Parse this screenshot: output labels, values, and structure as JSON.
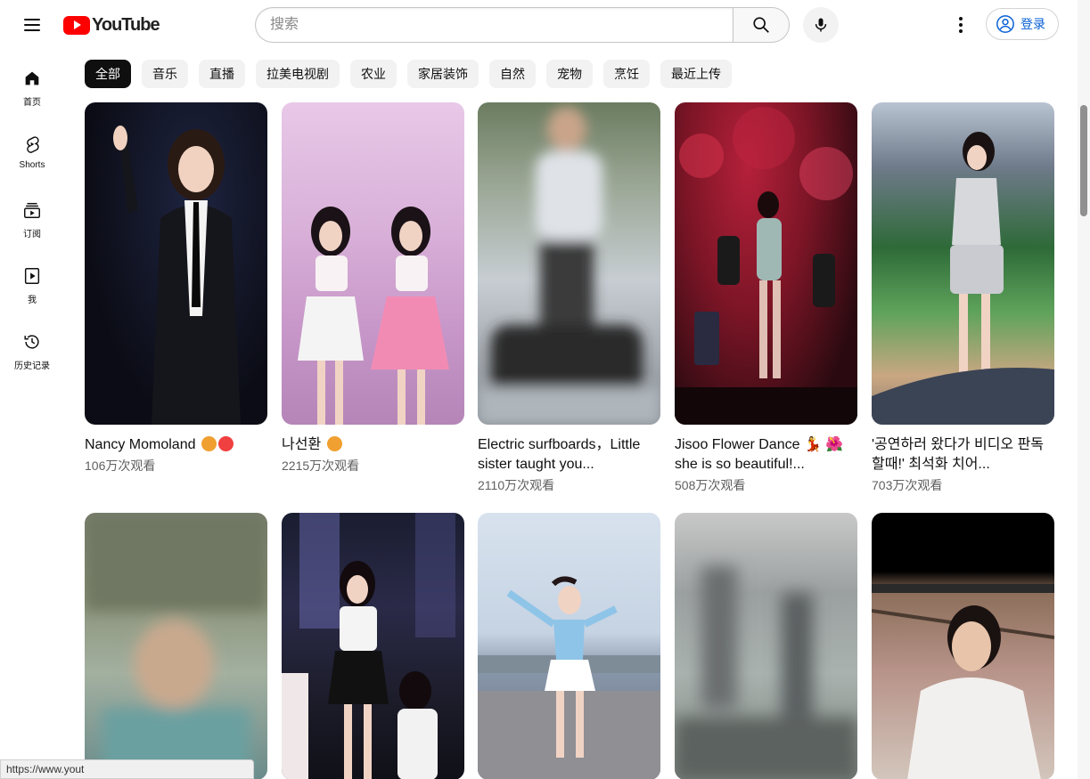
{
  "header": {
    "logo_text": "YouTube",
    "search_placeholder": "搜索",
    "signin_label": "登录"
  },
  "sidebar": {
    "items": [
      {
        "label": "首页",
        "icon": "home-icon"
      },
      {
        "label": "Shorts",
        "icon": "shorts-icon"
      },
      {
        "label": "订阅",
        "icon": "subscriptions-icon"
      },
      {
        "label": "我",
        "icon": "you-icon"
      },
      {
        "label": "历史记录",
        "icon": "history-icon"
      }
    ]
  },
  "chips": [
    "全部",
    "音乐",
    "直播",
    "拉美电视剧",
    "农业",
    "家居装饰",
    "自然",
    "宠物",
    "烹饪",
    "最近上传"
  ],
  "videos": [
    {
      "title": "Nancy Momoland",
      "emojis": [
        "#f0a030",
        "#f0a030"
      ],
      "views": "106万次观看"
    },
    {
      "title": "나선환",
      "emojis": [
        "#f0a030"
      ],
      "views": "2215万次观看"
    },
    {
      "title": "Electric surfboards，Little sister taught you...",
      "emojis": [],
      "views": "2110万次观看"
    },
    {
      "title": "Jisoo Flower Dance 💃 🌺 she is so beautiful!...",
      "emojis": [],
      "views": "508万次观看"
    },
    {
      "title": "'공연하러 왔다가 비디오 판독 할때!' 최석화 치어...",
      "emojis": [],
      "views": "703万次观看"
    }
  ],
  "status_url": "https://www.yout",
  "colors": {
    "brand_red": "#ff0000",
    "link_blue": "#065fd4",
    "chip_bg": "#f2f2f2",
    "chip_active": "#0f0f0f"
  }
}
